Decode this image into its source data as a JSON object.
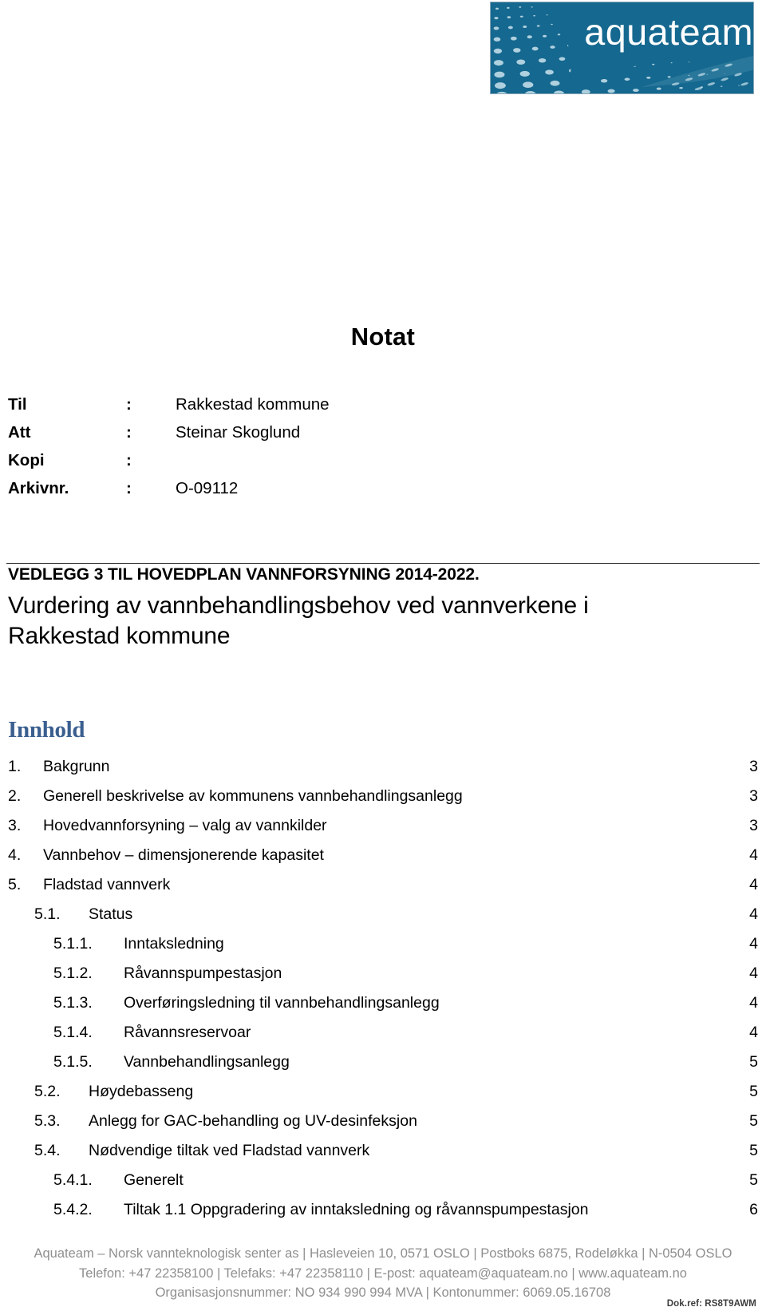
{
  "logo": {
    "brand": "aquateam",
    "bg_color": "#15688f",
    "dot_color": "#b9d7e4",
    "text_color": "#ffffff"
  },
  "title": "Notat",
  "meta": {
    "separator": ":",
    "rows": [
      {
        "label": "Til",
        "value": "Rakkestad kommune"
      },
      {
        "label": "Att",
        "value": "Steinar Skoglund"
      },
      {
        "label": "Kopi",
        "value": ""
      },
      {
        "label": "Arkivnr.",
        "value": "O-09112"
      }
    ]
  },
  "document": {
    "subtitle": "VEDLEGG 3 TIL HOVEDPLAN VANNFORSYNING 2014-2022.",
    "heading": "Vurdering av vannbehandlingsbehov ved vannverkene i Rakkestad kommune"
  },
  "toc": {
    "heading": "Innhold",
    "heading_color": "#3a5f8f",
    "entries": [
      {
        "num": "1.",
        "label": "Bakgrunn",
        "page": "3",
        "level": 1
      },
      {
        "num": "2.",
        "label": "Generell beskrivelse av kommunens vannbehandlingsanlegg",
        "page": "3",
        "level": 1
      },
      {
        "num": "3.",
        "label": "Hovedvannforsyning – valg av vannkilder",
        "page": "3",
        "level": 1
      },
      {
        "num": "4.",
        "label": "Vannbehov – dimensjonerende kapasitet",
        "page": "4",
        "level": 1
      },
      {
        "num": "5.",
        "label": "Fladstad vannverk",
        "page": "4",
        "level": 1
      },
      {
        "num": "5.1.",
        "label": "Status",
        "page": "4",
        "level": 2
      },
      {
        "num": "5.1.1.",
        "label": "Inntaksledning",
        "page": "4",
        "level": 3
      },
      {
        "num": "5.1.2.",
        "label": "Råvannspumpestasjon",
        "page": "4",
        "level": 3
      },
      {
        "num": "5.1.3.",
        "label": "Overføringsledning til vannbehandlingsanlegg",
        "page": "4",
        "level": 3
      },
      {
        "num": "5.1.4.",
        "label": "Råvannsreservoar",
        "page": "4",
        "level": 3
      },
      {
        "num": "5.1.5.",
        "label": "Vannbehandlingsanlegg",
        "page": "5",
        "level": 3
      },
      {
        "num": "5.2.",
        "label": "Høydebasseng",
        "page": "5",
        "level": 2
      },
      {
        "num": "5.3.",
        "label": "Anlegg for GAC-behandling og UV-desinfeksjon",
        "page": "5",
        "level": 2
      },
      {
        "num": "5.4.",
        "label": "Nødvendige tiltak ved Fladstad vannverk",
        "page": "5",
        "level": 2
      },
      {
        "num": "5.4.1.",
        "label": "Generelt",
        "page": "5",
        "level": 3
      },
      {
        "num": "5.4.2.",
        "label": "Tiltak 1.1 Oppgradering av inntaksledning og råvannspumpestasjon",
        "page": "6",
        "level": 3
      }
    ]
  },
  "footer": {
    "line1": "Aquateam – Norsk vannteknologisk senter as | Hasleveien 10, 0571 OSLO | Postboks 6875, Rodeløkka | N-0504 OSLO",
    "line2": "Telefon: +47 22358100 | Telefaks: +47 22358110 | E-post: aquateam@aquateam.no | www.aquateam.no",
    "line3": "Organisasjonsnummer: NO 934 990 994 MVA | Kontonummer: 6069.05.16708",
    "dokref": "Dok.ref: RS8T9AWM",
    "text_color": "#8f8f8f"
  }
}
